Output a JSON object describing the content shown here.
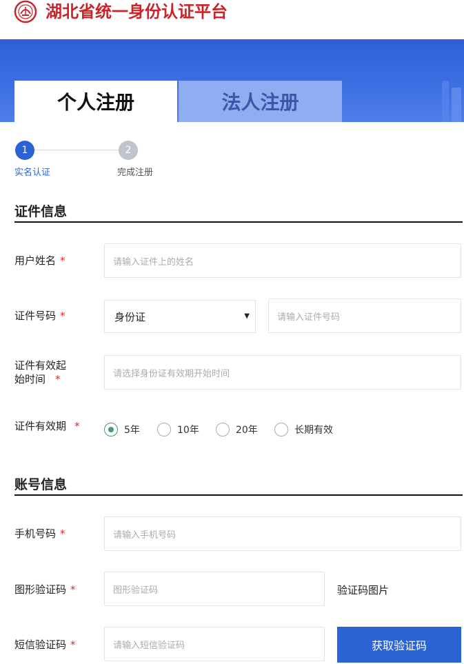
{
  "header": {
    "title": "湖北省统一身份认证平台"
  },
  "tabs": [
    {
      "label": "个人注册",
      "active": true
    },
    {
      "label": "法人注册",
      "active": false
    }
  ],
  "steps": [
    {
      "number": "1",
      "label": "实名认证",
      "active": true
    },
    {
      "number": "2",
      "label": "完成注册",
      "active": false
    }
  ],
  "sections": {
    "id_info": "证件信息",
    "account_info": "账号信息"
  },
  "form": {
    "name": {
      "label": "用户姓名",
      "required": "*",
      "placeholder": "请输入证件上的姓名"
    },
    "id_number": {
      "label": "证件号码",
      "required": "*",
      "type_value": "身份证",
      "placeholder": "请输入证件号码"
    },
    "valid_start": {
      "label_line1": "证件有效起",
      "label_line2": "始时间",
      "required": "*",
      "placeholder": "请选择身份证有效期开始时间"
    },
    "validity": {
      "label": "证件有效期",
      "required": "*",
      "options": [
        "5年",
        "10年",
        "20年",
        "长期有效"
      ],
      "selected": "5年"
    },
    "phone": {
      "label": "手机号码",
      "required": "*",
      "placeholder": "请输入手机号码"
    },
    "captcha": {
      "label": "图形验证码",
      "required": "*",
      "placeholder": "图形验证码",
      "image_text": "验证码图片"
    },
    "sms": {
      "label": "短信验证码",
      "required": "*",
      "placeholder": "请输入短信验证码",
      "button": "获取验证码"
    }
  },
  "colors": {
    "brand_red": "#c8242a",
    "primary_blue": "#2c63d4",
    "radio_checked": "#4a9a6e",
    "required": "#e02a2a"
  },
  "icons": [
    "emblem-logo-icon",
    "chevron-down-icon"
  ]
}
